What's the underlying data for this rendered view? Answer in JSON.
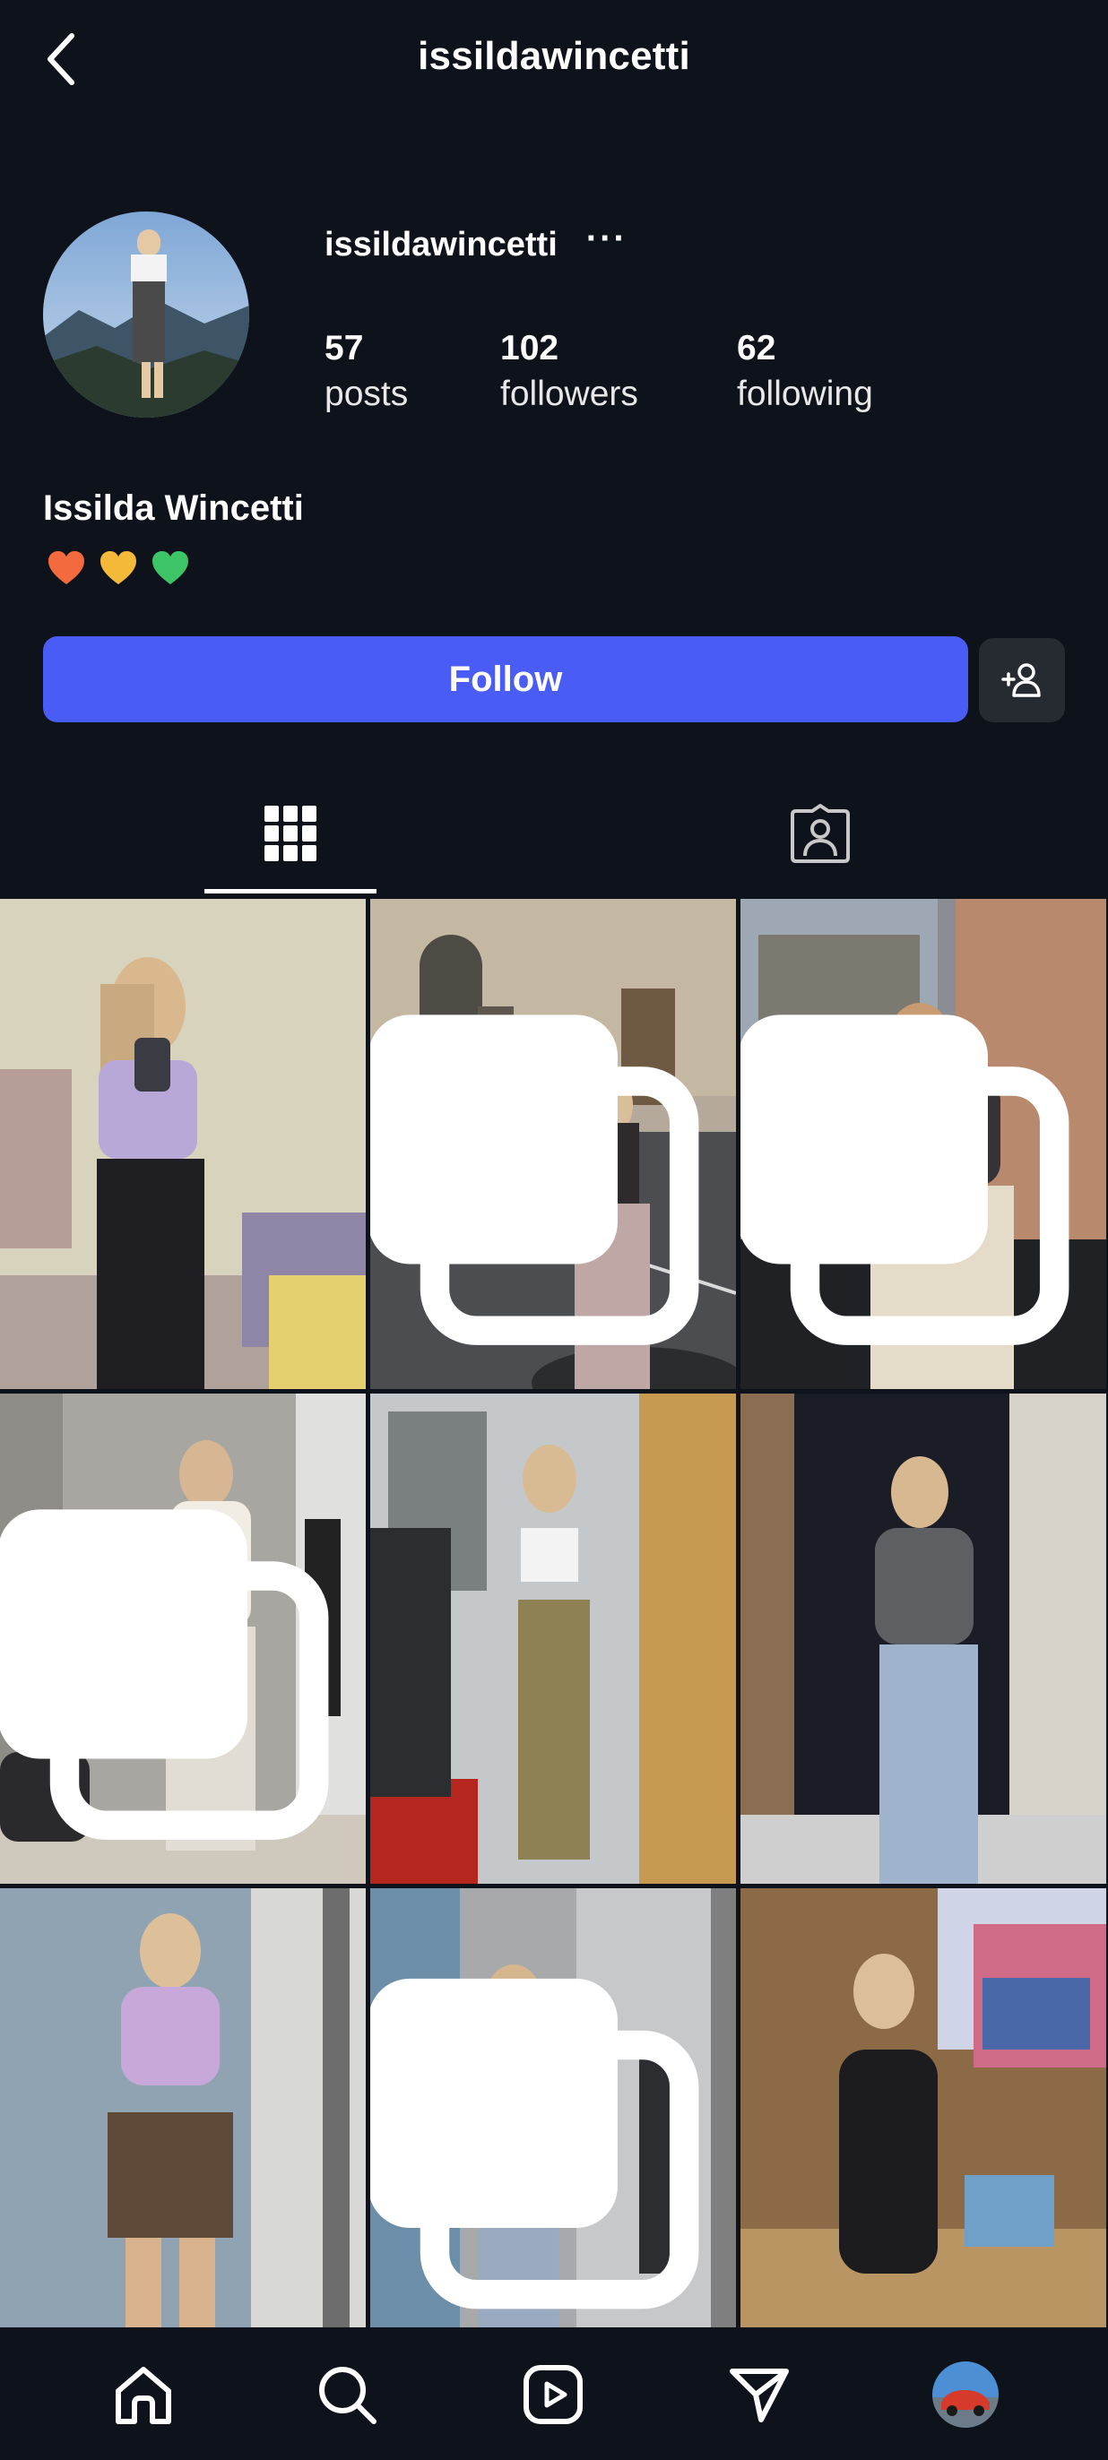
{
  "topbar": {
    "title": "issildawincetti"
  },
  "profile": {
    "username": "issildawincetti",
    "full_name": "Issilda Wincetti",
    "bio_emoji": [
      "orange-heart",
      "yellow-heart",
      "green-heart"
    ],
    "stats": [
      {
        "value": "57",
        "label": "posts"
      },
      {
        "value": "102",
        "label": "followers"
      },
      {
        "value": "62",
        "label": "following"
      }
    ]
  },
  "actions": {
    "follow_label": "Follow"
  },
  "colors": {
    "background": "#0e121a",
    "accent": "#4a5cf6",
    "secondary_button": "#262a31",
    "text": "#ffffff"
  },
  "tabs": [
    {
      "name": "posts-grid",
      "icon": "grid-icon",
      "active": true
    },
    {
      "name": "tagged",
      "icon": "tagged-person-icon",
      "active": false
    }
  ],
  "posts": [
    {
      "multi": false
    },
    {
      "multi": true
    },
    {
      "multi": true
    },
    {
      "multi": true
    },
    {
      "multi": false
    },
    {
      "multi": false
    },
    {
      "multi": false
    },
    {
      "multi": true
    },
    {
      "multi": false
    }
  ],
  "bottom_nav": [
    "home-icon",
    "search-icon",
    "reels-icon",
    "direct-icon",
    "profile-avatar"
  ]
}
